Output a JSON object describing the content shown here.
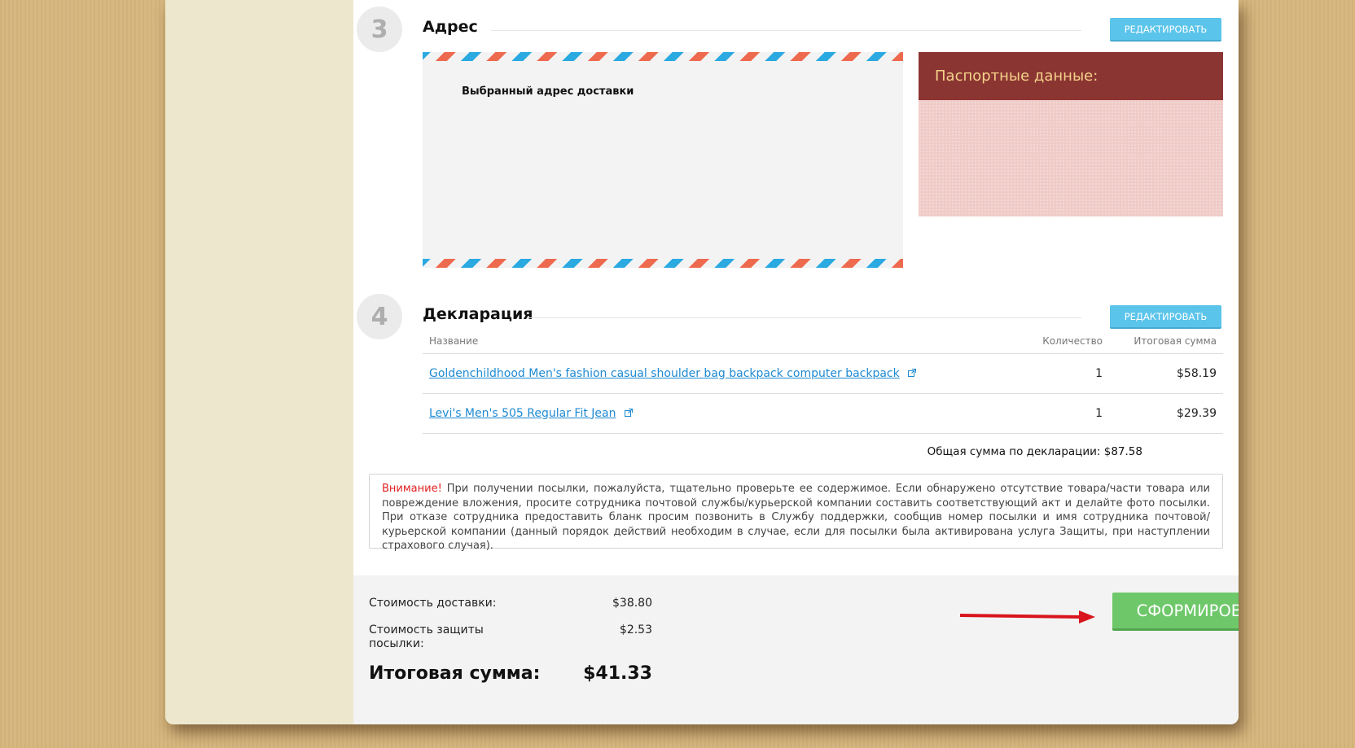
{
  "address_section": {
    "step": "3",
    "title": "Адрес",
    "edit_label": "РЕДАКТИРОВАТЬ",
    "envelope_label": "Выбранный адрес доставки",
    "passport_title": "Паспортные данные:"
  },
  "declaration_section": {
    "step": "4",
    "title": "Декларация",
    "edit_label": "РЕДАКТИРОВАТЬ",
    "columns": {
      "name": "Название",
      "quantity": "Количество",
      "total": "Итоговая сумма"
    },
    "items": [
      {
        "name": "Goldenchildhood Men's fashion casual shoulder bag backpack computer backpack",
        "quantity": "1",
        "total": "$58.19"
      },
      {
        "name": "Levi's Men's 505 Regular Fit Jean",
        "quantity": "1",
        "total": "$29.39"
      }
    ],
    "total_text": "Общая сумма по декларации: $87.58"
  },
  "warning": {
    "label": "Внимание!",
    "text": " При получении посылки, пожалуйста, тщательно проверьте ее содержимое. Если обнаружено отсутствие товара/части товара или повреждение вложения, просите сотрудника почтовой службы/курьерской компании составить соответствующий акт и делайте фото посылки. При отказе сотрудника предоставить бланк просим позвонить в Службу поддержки, сообщив номер посылки и имя сотрудника почтовой/курьерской компании (данный порядок действий необходим в случае, если для посылки была активирована услуга Защиты, при наступлении страхового случая)."
  },
  "summary": {
    "delivery_label": "Стоимость доставки:",
    "delivery_value": "$38.80",
    "protection_label": "Стоимость защиты посылки:",
    "protection_value": "$2.53",
    "total_label": "Итоговая сумма:",
    "total_value": "$41.33",
    "submit_label": "СФОРМИРОВАТЬ ПОСЫЛКУ"
  },
  "colors": {
    "edit_button": "#5bc4ea",
    "submit_button": "#6ec86a",
    "passport_header": "#8b3533",
    "passport_body": "#efcbc7",
    "link": "#1e8ad2",
    "warning_accent": "#e02020",
    "arrow": "#d9141c"
  },
  "icons": [
    "external-link-icon",
    "right-arrow-icon"
  ]
}
